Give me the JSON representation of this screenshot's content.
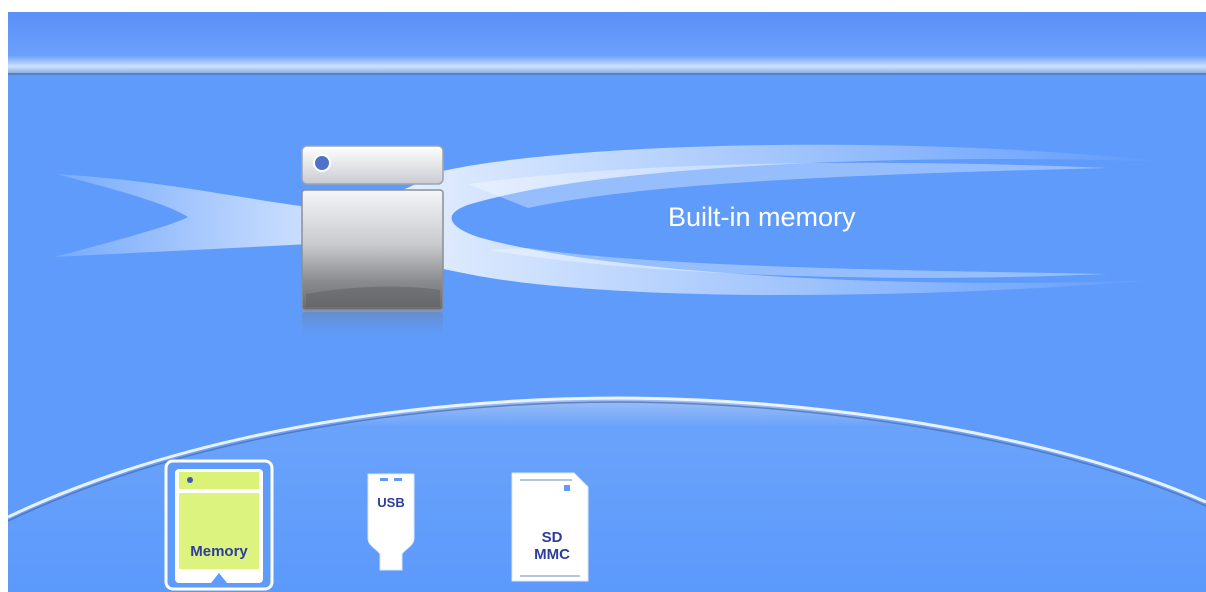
{
  "selected_source": {
    "title": "Built-in memory",
    "icon": "built-in-memory-icon"
  },
  "sources": [
    {
      "id": "memory",
      "label": "Memory",
      "icon": "memory-card-icon",
      "selected": true
    },
    {
      "id": "usb",
      "label": "USB",
      "icon": "usb-drive-icon",
      "selected": false
    },
    {
      "id": "sd",
      "label": [
        "SD",
        "MMC"
      ],
      "icon": "sd-card-icon",
      "selected": false
    }
  ],
  "colors": {
    "background": "#5e9bfb",
    "selected_highlight": "#d8f26a",
    "icon_label": "#2b3e9b"
  }
}
